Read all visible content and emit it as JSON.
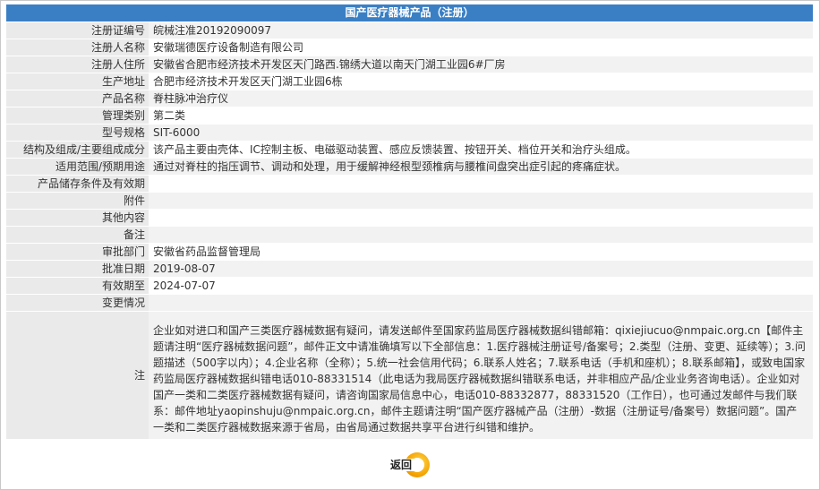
{
  "title": "国产医疗器械产品（注册）",
  "rows": [
    {
      "label": "注册证编号",
      "value": "皖械注准20192090097"
    },
    {
      "label": "注册人名称",
      "value": "安徽瑞德医疗设备制造有限公司"
    },
    {
      "label": "注册人住所",
      "value": "安徽省合肥市经济技术开发区天门路西.锦绣大道以南天门湖工业园6#厂房"
    },
    {
      "label": "生产地址",
      "value": "合肥市经济技术开发区天门湖工业园6栋"
    },
    {
      "label": "产品名称",
      "value": "脊柱脉冲治疗仪"
    },
    {
      "label": "管理类别",
      "value": "第二类"
    },
    {
      "label": "型号规格",
      "value": "SIT-6000"
    },
    {
      "label": "结构及组成/主要组成成分",
      "value": "该产品主要由壳体、IC控制主板、电磁驱动装置、感应反馈装置、按钮开关、档位开关和治疗头组成。"
    },
    {
      "label": "适用范围/预期用途",
      "value": "通过对脊柱的指压调节、调动和处理，用于缓解神经根型颈椎病与腰椎间盘突出症引起的疼痛症状。"
    },
    {
      "label": "产品储存条件及有效期",
      "value": ""
    },
    {
      "label": "附件",
      "value": ""
    },
    {
      "label": "其他内容",
      "value": ""
    },
    {
      "label": "备注",
      "value": ""
    },
    {
      "label": "审批部门",
      "value": "安徽省药品监督管理局"
    },
    {
      "label": "批准日期",
      "value": "2019-08-07"
    },
    {
      "label": "有效期至",
      "value": "2024-07-07"
    },
    {
      "label": "变更情况",
      "value": ""
    }
  ],
  "note": {
    "label": "注",
    "text": "企业如对进口和国产三类医疗器械数据有疑问，请发送邮件至国家药监局医疗器械数据纠错邮箱：qixiejiucuo@nmpaic.org.cn【邮件主题请注明“医疗器械数据问题”，邮件正文中请准确填写以下全部信息：1.医疗器械注册证号/备案号；2.类型（注册、变更、延续等）；3.问题描述（500字以内）；4.企业名称（全称）；5.统一社会信用代码；6.联系人姓名；7.联系电话（手机和座机）；8.联系邮箱】，或致电国家药监局医疗器械数据纠错电话010-88331514（此电话为我局医疗器械数据纠错联系电话，并非相应产品/企业业务咨询电话）。企业如对国产一类和二类医疗器械数据有疑问，请咨询国家局信息中心，电话010-88332877，88331520（工作日），也可通过发邮件与我们联系：邮件地址yaopinshuju@nmpaic.org.cn，邮件主题请注明“国产医疗器械产品（注册）-数据（注册证号/备案号）数据问题”。国产一类和二类医疗器械数据来源于省局，由省局通过数据共享平台进行纠错和维护。"
  },
  "back_button": {
    "label": "返回",
    "icon": "back-circle-icon",
    "color": "#f4a300"
  },
  "colors": {
    "title_bar": "#3a7fc4",
    "label_bg": "#eaeaea",
    "value_bg": "#f2f2f2"
  }
}
